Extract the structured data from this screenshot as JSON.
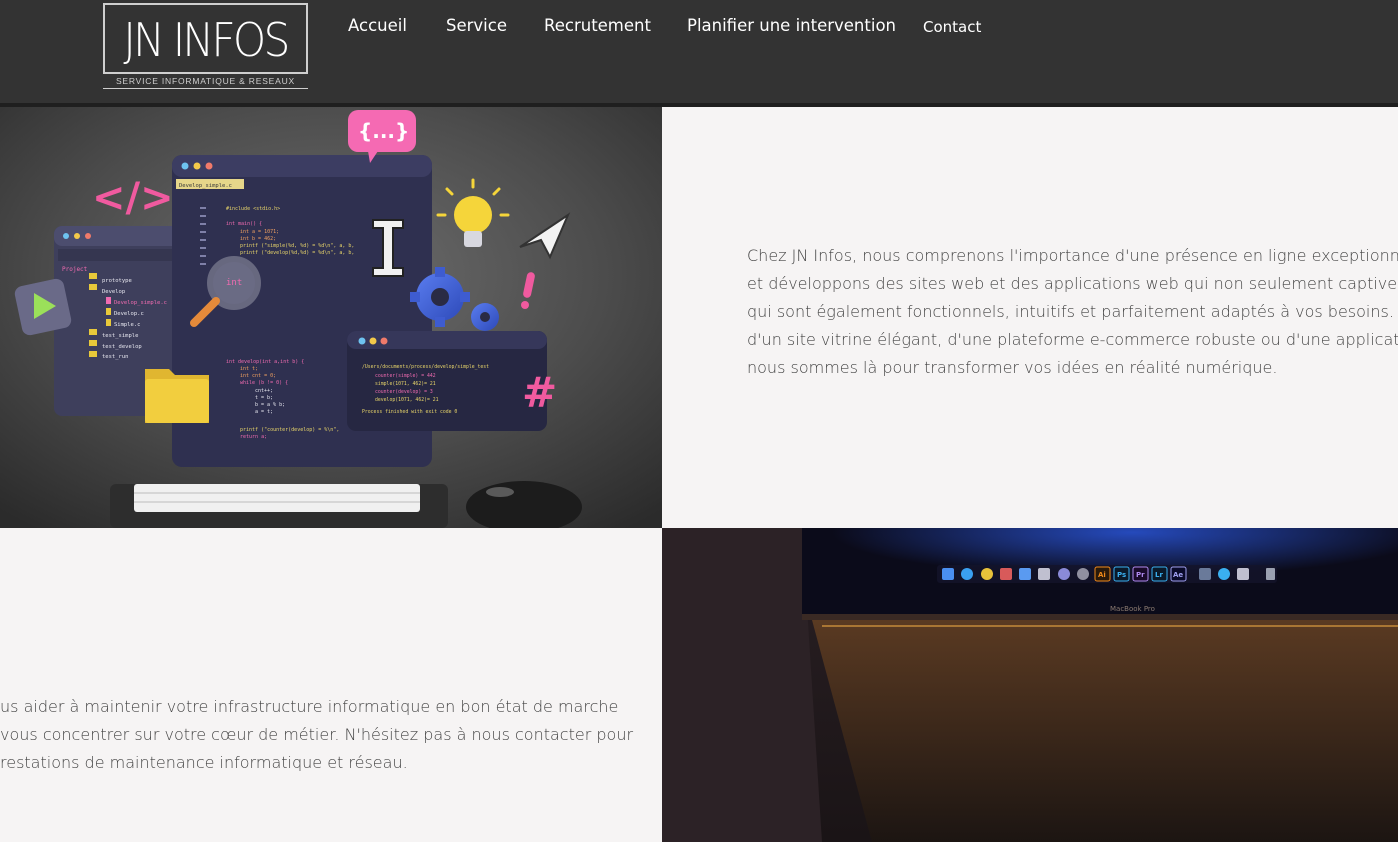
{
  "brand": {
    "logo_text": "JN INFOS",
    "tagline": "SERVICE INFORMATIQUE & RESEAUX"
  },
  "nav": {
    "items": [
      {
        "label": "Accueil"
      },
      {
        "label": "Service"
      },
      {
        "label": "Recrutement"
      },
      {
        "label": "Planifier une intervention"
      },
      {
        "label": "Contact"
      }
    ]
  },
  "colors": {
    "header_bg": "#333333",
    "page_bg": "#f6f4f4",
    "text": "#444444"
  },
  "section_web": {
    "lines": [
      "Chez JN Infos, nous comprenons l'importance d'une présence en ligne exceptionnelle. Nous",
      "et développons des sites web et des applications web qui non seulement captivent votre pu",
      "qui sont également fonctionnels, intuitifs et parfaitement adaptés à vos besoins. Que vous a",
      "d'un site vitrine élégant, d'une plateforme e-commerce robuste ou d'une application web su",
      "nous sommes là pour transformer vos idées en réalité numérique."
    ]
  },
  "section_maintenance": {
    "lines": [
      "us aider à maintenir votre infrastructure informatique en bon état de marche",
      "vous concentrer sur votre cœur de métier. N'hésitez pas à nous contacter pour",
      "restations de maintenance informatique et réseau."
    ]
  },
  "illustration": {
    "code_tab": "Develop_simple.c",
    "tree": [
      "Project",
      "prototype",
      "Develop",
      "Develop_simple.c",
      "Develop.c",
      "Simple.c",
      "test_simple",
      "test_develop",
      "test_run"
    ],
    "code_lines": [
      "#include <stdio.h>",
      "int main() {",
      "int a = 1071;",
      "int b = 462;",
      "printf (\"simple(%d, %d) = %d\\n\", a, b,",
      "printf (\"develop(%d,%d) = %d\\n\", a, b,",
      "int develop(int a,int b) {",
      "int t;",
      "int cnt = 0;",
      "while (b != 0) {",
      "cnt++;",
      "t = b;",
      "b = a % b;",
      "a = t;",
      "printf (\"counter(develop) = %\\n\",",
      "return a;"
    ],
    "terminal_lines": [
      "/Users/documents/process/develop/simple_test",
      "counter(simple) = 442",
      "simple(1071, 462)= 21",
      "counter(develop) = 3",
      "develop(1071, 462)= 21",
      "Process finished with exit code 0"
    ],
    "bubble": "{...}",
    "tag": "</>",
    "lens_label": "int",
    "dock_icons": [
      "Ai",
      "Ps",
      "Pr",
      "Lr",
      "Ae"
    ],
    "laptop_label": "MacBook Pro"
  }
}
